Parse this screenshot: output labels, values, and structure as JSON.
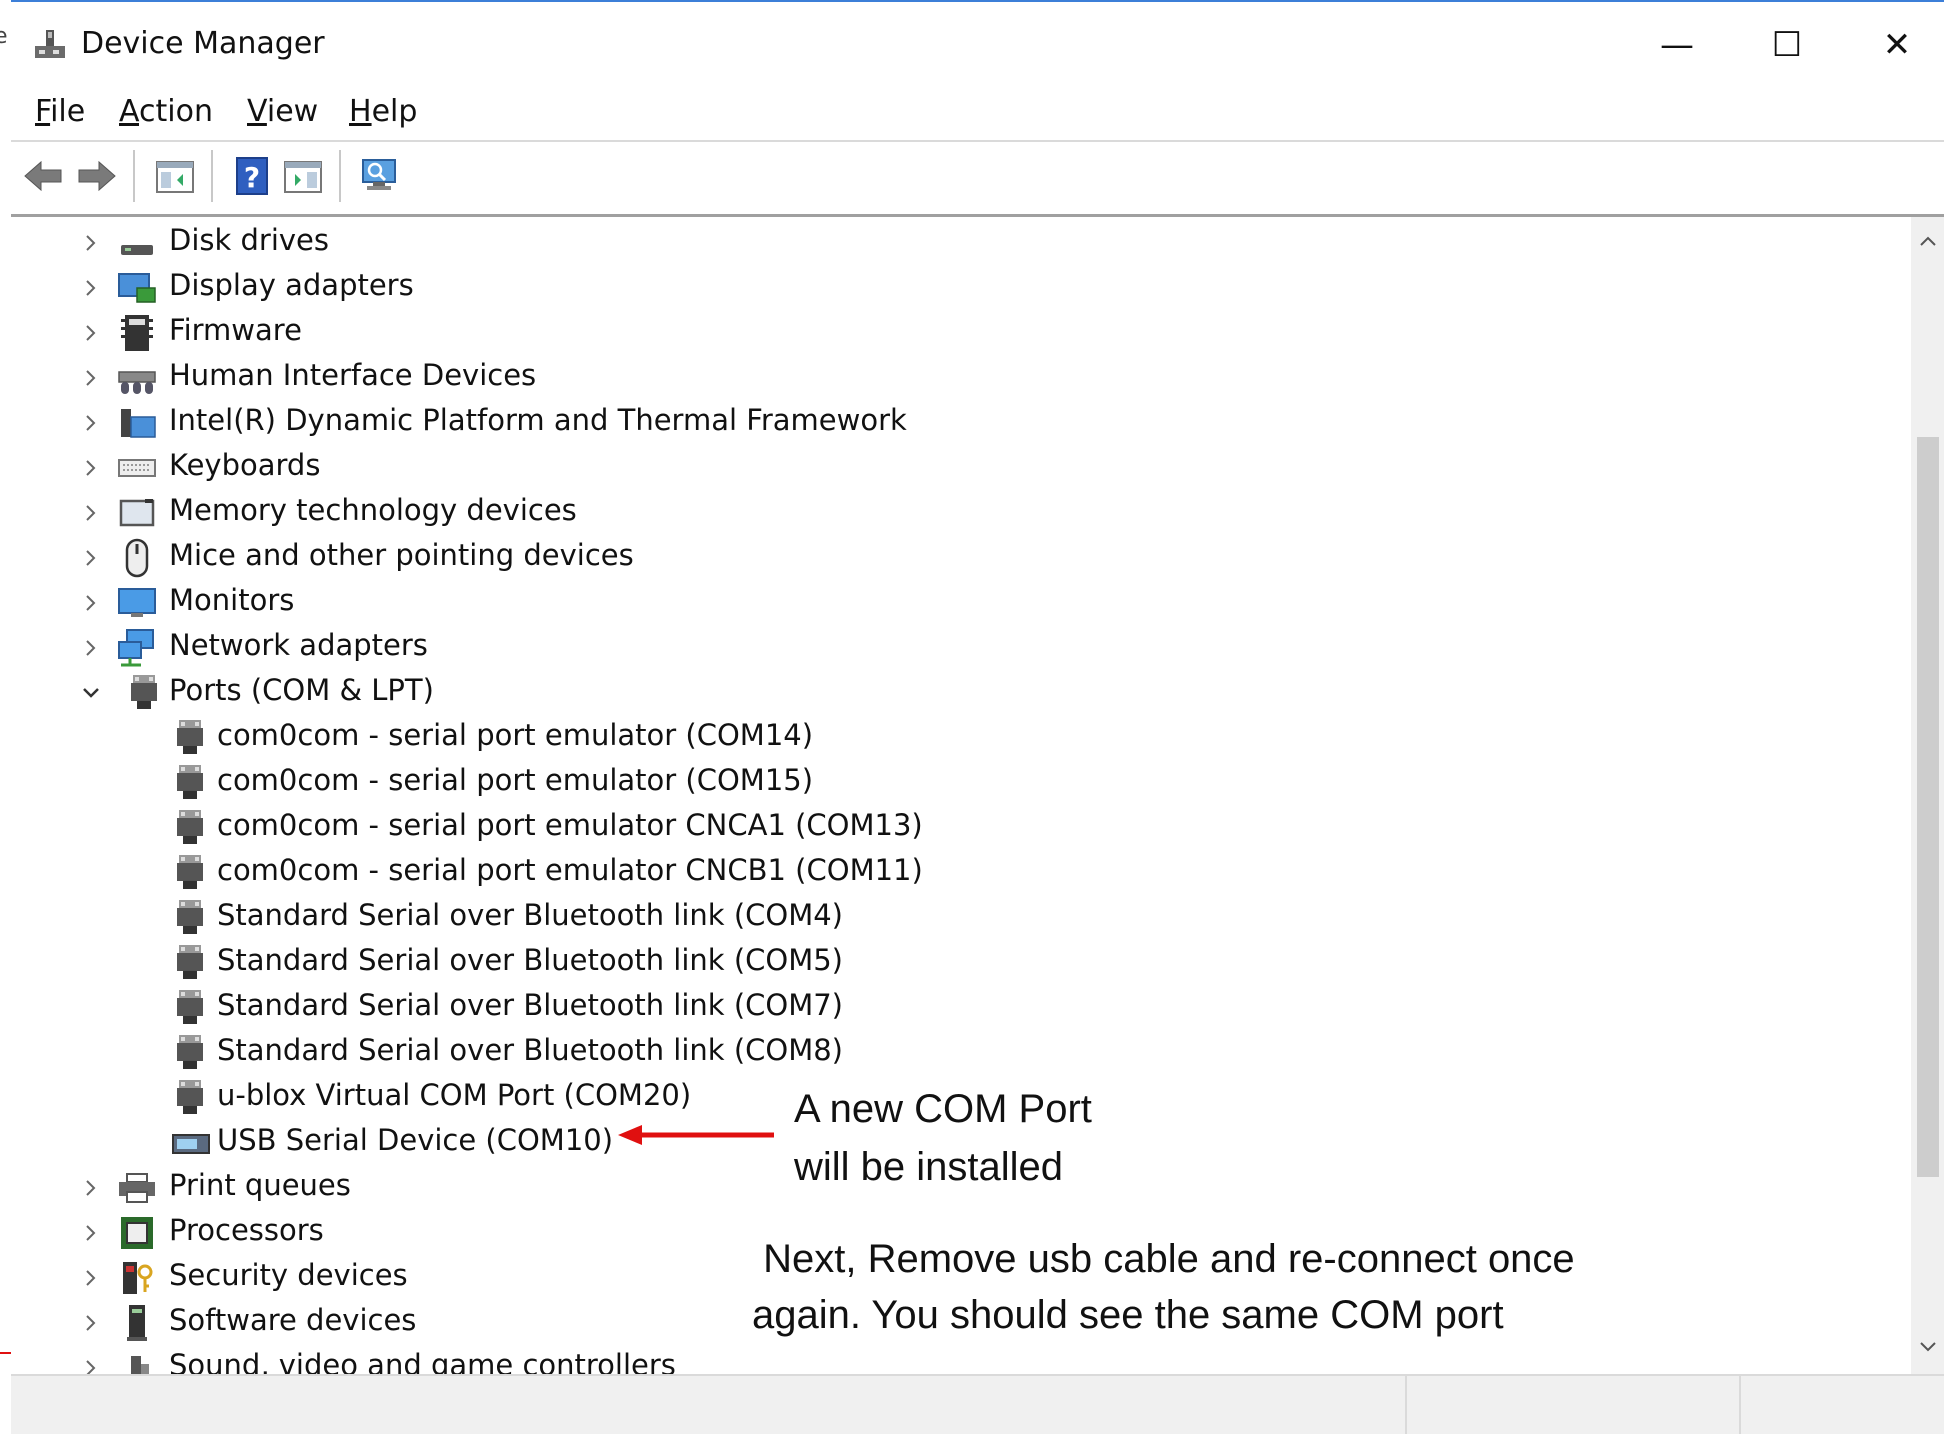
{
  "window": {
    "title": "Device Manager",
    "controls": {
      "minimize": "—",
      "maximize": "☐",
      "close": "✕"
    }
  },
  "menubar": {
    "items": [
      {
        "label": "File",
        "accel": "F",
        "rest": "ile"
      },
      {
        "label": "Action",
        "accel": "A",
        "rest": "ction"
      },
      {
        "label": "View",
        "accel": "V",
        "rest": "iew"
      },
      {
        "label": "Help",
        "accel": "H",
        "rest": "elp"
      }
    ]
  },
  "toolbar": {
    "icons": [
      "back-arrow-icon",
      "forward-arrow-icon",
      "show-hide-console-tree-icon",
      "help-icon",
      "show-hide-action-pane-icon",
      "scan-hardware-icon"
    ]
  },
  "tree": {
    "categories_top": [
      {
        "label": "Disk drives",
        "icon": "disk-drive-icon"
      },
      {
        "label": "Display adapters",
        "icon": "display-adapter-icon"
      },
      {
        "label": "Firmware",
        "icon": "firmware-icon"
      },
      {
        "label": "Human Interface Devices",
        "icon": "hid-icon"
      },
      {
        "label": "Intel(R) Dynamic Platform and Thermal Framework",
        "icon": "folder-icon"
      },
      {
        "label": "Keyboards",
        "icon": "keyboard-icon"
      },
      {
        "label": "Memory technology devices",
        "icon": "memory-device-icon"
      },
      {
        "label": "Mice and other pointing devices",
        "icon": "mouse-icon"
      },
      {
        "label": "Monitors",
        "icon": "monitor-icon"
      },
      {
        "label": "Network adapters",
        "icon": "network-adapter-icon"
      }
    ],
    "ports": {
      "label": "Ports (COM & LPT)",
      "icon": "port-icon",
      "children": [
        {
          "label": "com0com - serial port emulator (COM14)",
          "icon": "port-icon"
        },
        {
          "label": "com0com - serial port emulator (COM15)",
          "icon": "port-icon"
        },
        {
          "label": "com0com - serial port emulator CNCA1 (COM13)",
          "icon": "port-icon"
        },
        {
          "label": "com0com - serial port emulator CNCB1 (COM11)",
          "icon": "port-icon"
        },
        {
          "label": "Standard Serial over Bluetooth link (COM4)",
          "icon": "port-icon"
        },
        {
          "label": "Standard Serial over Bluetooth link (COM5)",
          "icon": "port-icon"
        },
        {
          "label": "Standard Serial over Bluetooth link (COM7)",
          "icon": "port-icon"
        },
        {
          "label": "Standard Serial over Bluetooth link (COM8)",
          "icon": "port-icon"
        },
        {
          "label": "u-blox Virtual COM Port (COM20)",
          "icon": "port-icon"
        },
        {
          "label": "USB Serial Device (COM10)",
          "icon": "usb-serial-icon"
        }
      ]
    },
    "categories_bottom": [
      {
        "label": "Print queues",
        "icon": "printer-icon"
      },
      {
        "label": "Processors",
        "icon": "processor-icon"
      },
      {
        "label": "Security devices",
        "icon": "security-device-icon"
      },
      {
        "label": "Software devices",
        "icon": "software-device-icon"
      },
      {
        "label": "Sound, video and game controllers",
        "icon": "sound-icon"
      }
    ]
  },
  "annotations": {
    "new_port_line1": "A new COM Port",
    "new_port_line2": "will be installed",
    "next_line1": " Next, Remove usb cable and re-connect once",
    "next_line2": "again. You should see the same COM port"
  },
  "colors": {
    "accent": "#3c7fd8",
    "arrow": "#e01010"
  }
}
